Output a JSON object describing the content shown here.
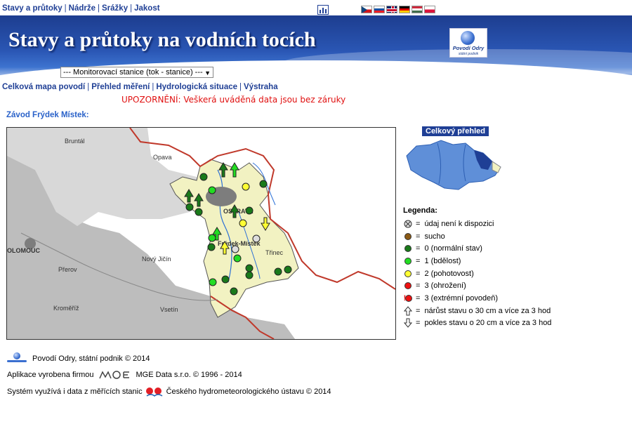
{
  "topnav": {
    "items": [
      "Stavy a průtoky",
      "Nádrže",
      "Srážky",
      "Jakost"
    ]
  },
  "icons": {
    "chart": "bar-chart-icon",
    "flags": [
      {
        "name": "flag-czech-icon",
        "colors": [
          "#ffffff",
          "#d7141a",
          "#11457e"
        ]
      },
      {
        "name": "flag-slovak-icon",
        "colors": [
          "#ffffff",
          "#0b4ea2",
          "#ee1c25"
        ]
      },
      {
        "name": "flag-english-icon",
        "colors": [
          "#012169",
          "#ffffff",
          "#c8102e"
        ]
      },
      {
        "name": "flag-german-icon",
        "colors": [
          "#000000",
          "#dd0000",
          "#ffce00"
        ]
      },
      {
        "name": "flag-hungarian-icon",
        "colors": [
          "#cd2a3e",
          "#ffffff",
          "#436f4d"
        ]
      },
      {
        "name": "flag-polish-icon",
        "colors": [
          "#ffffff",
          "#dc143c",
          "#dc143c"
        ]
      }
    ]
  },
  "banner": {
    "title": "Stavy a průtoky na vodních tocích",
    "logo_text": "Povodí Odry",
    "logo_sub": "státní podnik"
  },
  "station_select": {
    "selected": "--- Monitorovací stanice (tok - stanice) ---"
  },
  "subnav": {
    "items": [
      "Celková mapa povodí",
      "Přehled měření",
      "Hydrologická situace",
      "Výstraha"
    ]
  },
  "warning": "UPOZORNĚNÍ: Veškerá uváděná data jsou bez záruky",
  "region_title": "Závod Frýdek Místek:",
  "map": {
    "labels": [
      {
        "name": "map-label-bruntal",
        "text": "Bruntál"
      },
      {
        "name": "map-label-opava",
        "text": "Opava"
      },
      {
        "name": "map-label-ostrava",
        "text": "OSTRAVA"
      },
      {
        "name": "map-label-olomouc",
        "text": "OLOMOUC"
      },
      {
        "name": "map-label-novy-jicin",
        "text": "Nový Jičín"
      },
      {
        "name": "map-label-prerov",
        "text": "Přerov"
      },
      {
        "name": "map-label-frydek-mistek",
        "text": "Frýdek-Místek"
      },
      {
        "name": "map-label-trinec",
        "text": "Třinec"
      },
      {
        "name": "map-label-kromeriz",
        "text": "Kroměříž"
      },
      {
        "name": "map-label-vsetin",
        "text": "Vsetín"
      }
    ]
  },
  "overview": {
    "title": "Celkový přehled"
  },
  "legend": {
    "title": "Legenda:",
    "items": [
      {
        "label": "údaj není k dispozici",
        "icon": "no-data-icon"
      },
      {
        "label": "sucho",
        "icon": "brown-dot-icon",
        "color": "#8b5a14"
      },
      {
        "label": "0 (normální stav)",
        "icon": "dark-green-dot-icon",
        "color": "#1a7a1a"
      },
      {
        "label": "1 (bdělost)",
        "icon": "light-green-dot-icon",
        "color": "#22dd22"
      },
      {
        "label": "2 (pohotovost)",
        "icon": "yellow-dot-icon",
        "color": "#ffff33"
      },
      {
        "label": "3 (ohrožení)",
        "icon": "red-dot-icon",
        "color": "#ee1111"
      },
      {
        "label": "3 (extrémní povodeň)",
        "icon": "extreme-flood-icon",
        "color": "#ee1111"
      },
      {
        "label": "nárůst stavu o 30 cm a více za 3 hod",
        "icon": "arrow-up-icon"
      },
      {
        "label": "pokles stavu o 20 cm a více za 3 hod",
        "icon": "arrow-down-icon"
      }
    ],
    "equals": "="
  },
  "footer": {
    "copyright": "Povodí Odry, státní podnik © 2014",
    "app_prefix": "Aplikace vyrobena firmou",
    "app_vendor": "MGE Data s.r.o. © 1996 - 2014",
    "system_prefix": "Systém využívá i data z měřících stanic",
    "system_source": "Českého hydrometeorologického ústavu © 2014"
  }
}
